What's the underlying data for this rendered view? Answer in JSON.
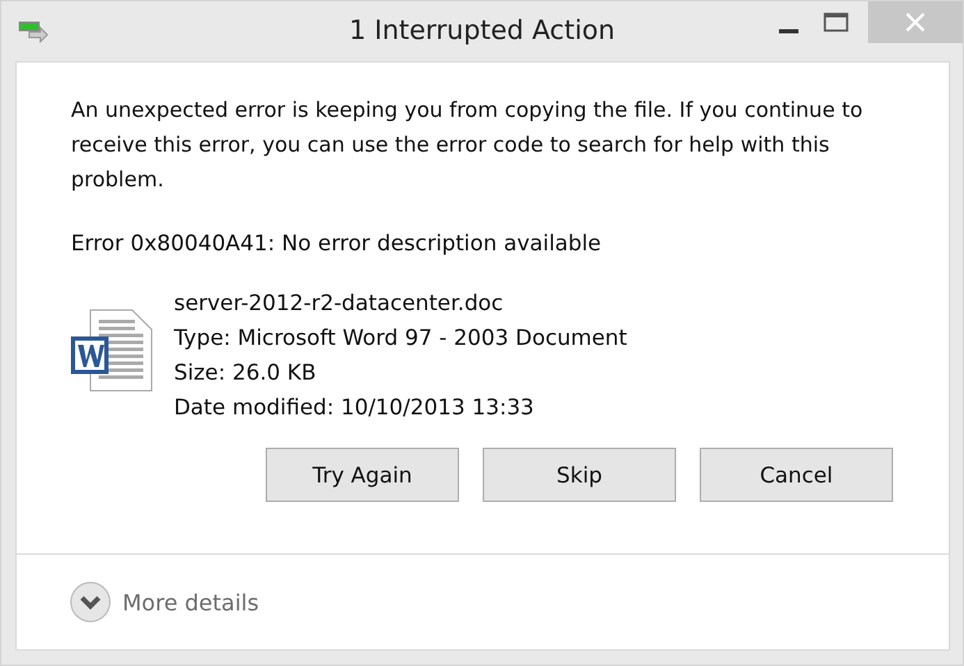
{
  "window": {
    "title": "1 Interrupted Action"
  },
  "message": "An unexpected error is keeping you from copying the file. If you continue to receive this error, you can use the error code to search for help with this problem.",
  "error": "Error 0x80040A41: No error description available",
  "file": {
    "name": "server-2012-r2-datacenter.doc",
    "type": "Type: Microsoft Word 97 - 2003 Document",
    "size": "Size: 26.0 KB",
    "modified": "Date modified: 10/10/2013 13:33"
  },
  "buttons": [
    "Try Again",
    "Skip",
    "Cancel"
  ],
  "details": {
    "label": "More details",
    "expanded": false
  }
}
